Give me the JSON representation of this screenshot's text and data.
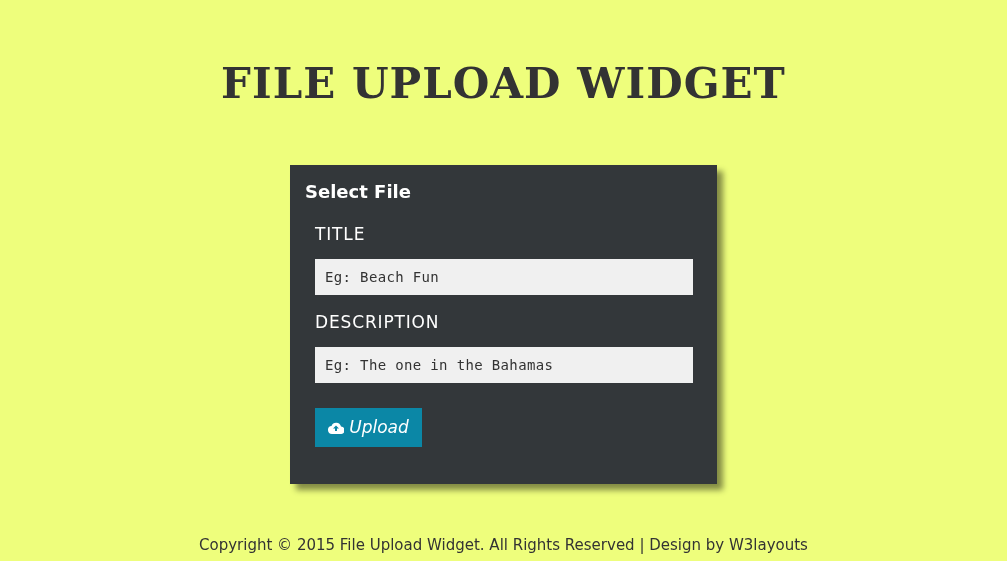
{
  "title": "FILE UPLOAD WIDGET",
  "card": {
    "heading": "Select File",
    "fields": [
      {
        "label": "TITLE",
        "placeholder": "Eg: Beach Fun"
      },
      {
        "label": "DESCRIPTION",
        "placeholder": "Eg: The one in the Bahamas"
      }
    ],
    "button": "Upload"
  },
  "footer": "Copyright © 2015 File Upload Widget. All Rights Reserved | Design by W3layouts"
}
